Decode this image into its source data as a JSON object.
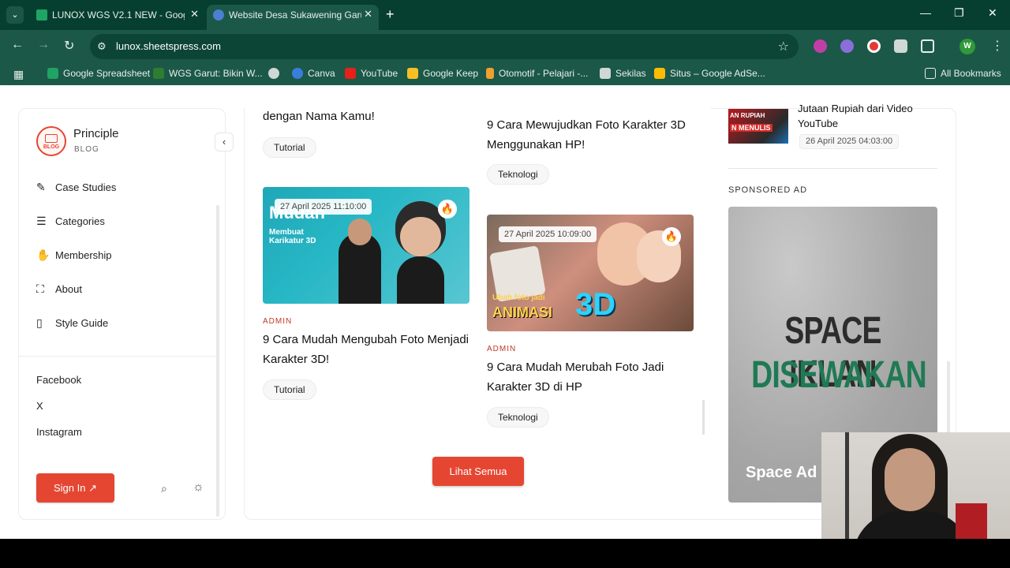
{
  "browser": {
    "tabs": [
      {
        "title": "LUNOX WGS V2.1 NEW - Googl",
        "active": false
      },
      {
        "title": "Website Desa Sukawening Garut",
        "active": true
      }
    ],
    "url": "lunox.sheetspress.com",
    "profile_initial": "W",
    "bookmarks": [
      "Google Spreadsheet",
      "WGS Garut: Bikin W...",
      "Canva",
      "YouTube",
      "Google Keep",
      "Otomotif - Pelajari -...",
      "Sekilas",
      "Situs – Google AdSe...",
      "All Bookmarks"
    ]
  },
  "sidebar": {
    "brand_name": "Principle",
    "brand_sub": "BLOG",
    "logo_text": "BLOG",
    "nav": [
      "Case Studies",
      "Categories",
      "Membership",
      "About",
      "Style Guide"
    ],
    "social": [
      "Facebook",
      "X",
      "Instagram"
    ],
    "signin_label": "Sign In ↗"
  },
  "main": {
    "cards": [
      {
        "title": "dengan Nama Kamu!",
        "tag": "Tutorial"
      },
      {
        "title": "9 Cara Mewujudkan Foto Karakter 3D Menggunakan HP!",
        "tag": "Teknologi"
      },
      {
        "date": "27 April 2025 11:10:00",
        "image_text_1": "Mudah",
        "image_text_2": "Membuat\nKarikatur 3D",
        "author": "ADMIN",
        "title": "9 Cara Mudah Mengubah Foto Menjadi Karakter 3D!",
        "tag": "Tutorial"
      },
      {
        "date": "27 April 2025 10:09:00",
        "image_text_1": "Ubah foto jadi",
        "image_text_2": "ANIMASI",
        "image_text_3": "3D",
        "author": "ADMIN",
        "title": "9 Cara Mudah Merubah Foto Jadi Karakter 3D di HP",
        "tag": "Teknologi"
      }
    ],
    "more_label": "Lihat Semua"
  },
  "right": {
    "post_title": "Jutaan Rupiah dari Video YouTube",
    "post_date": "26 April 2025 04:03:00",
    "thumb_text_1": "AN RUPIAH",
    "thumb_text_2": "N MENULIS",
    "sponsored_label": "SPONSORED AD",
    "ad_line1": "SPACE IKLAN",
    "ad_line2": "DISEWAKAN",
    "ad_caption": "Space Ad"
  },
  "colors": {
    "accent": "#e54632",
    "browser_dark": "#063f2f",
    "browser_mid": "#1c5847"
  }
}
